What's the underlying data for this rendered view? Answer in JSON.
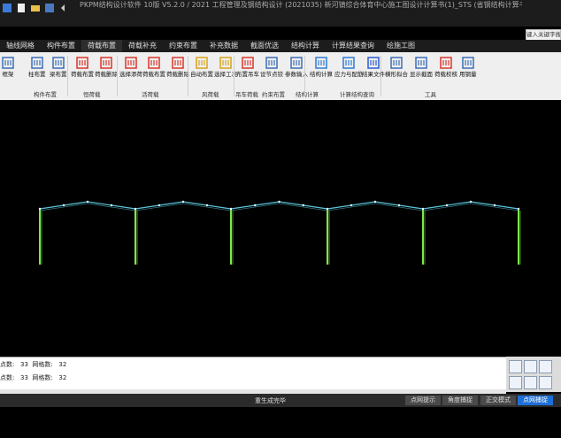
{
  "window": {
    "title": "PKPM结构设计软件 10版 V5.2.0 / 2021 工程管理及钢结构设计 (2021035) 新河镇综合体育中心施工图设计计算书(1)_STS (省钢结构计算书)",
    "search_placeholder": "键入关键字搜索"
  },
  "tabs": [
    "轴线网格",
    "构件布置",
    "荷载布置",
    "荷载补充",
    "约束布置",
    "补充数据",
    "截面优选",
    "结构计算",
    "计算结果查询",
    "绘施工图"
  ],
  "active_tab": 2,
  "ribbon": {
    "tools": [
      {
        "label": "框架",
        "icon": "frame-icon"
      },
      {
        "label": "柱布置",
        "icon": "column-icon"
      },
      {
        "label": "梁布置",
        "icon": "beam-icon"
      },
      {
        "label": "荷载布置",
        "icon": "load-arrows-icon"
      },
      {
        "label": "荷载删除",
        "icon": "load-delete-icon"
      },
      {
        "label": "选择添荷",
        "icon": "select-load-icon"
      },
      {
        "label": "荷载布置",
        "icon": "live-load-icon"
      },
      {
        "label": "荷载删除",
        "icon": "live-load-delete-icon"
      },
      {
        "label": "自动布置",
        "icon": "wind-auto-icon"
      },
      {
        "label": "选择工况",
        "icon": "wind-case-icon"
      },
      {
        "label": "布置吊车",
        "icon": "crane-icon"
      },
      {
        "label": "设节点铰",
        "icon": "hinge-icon"
      },
      {
        "label": "参数输入",
        "icon": "parameters-icon"
      },
      {
        "label": "结构计算",
        "icon": "run-icon"
      },
      {
        "label": "应力与配筋",
        "icon": "stress-icon"
      },
      {
        "label": "结果文件",
        "icon": "word-file-icon"
      },
      {
        "label": "横形拟合",
        "icon": "fit-icon"
      },
      {
        "label": "显示截面",
        "icon": "section-icon"
      },
      {
        "label": "荷载校核",
        "icon": "load-check-icon"
      },
      {
        "label": "用钢量",
        "icon": "steel-qty-icon"
      }
    ],
    "groups": [
      "构件布置",
      "恒荷载",
      "活荷载",
      "风荷载",
      "吊车荷载",
      "约束布置",
      "结构计算",
      "计算结构查询",
      "工具"
    ]
  },
  "command": {
    "lines": [
      "点数:   33  网格数:   32",
      "点数:   33  网格数:   32"
    ]
  },
  "status": {
    "message": "重生成完毕",
    "buttons": [
      "点网提示",
      "角度捕捉",
      "正交模式",
      "点网捕捉"
    ],
    "active_button": 3
  },
  "colors": {
    "background": "#000000",
    "column": "#7ee84a",
    "rafter": "#59c6dc",
    "node": "#ffffff",
    "accent": "#1e6fd6"
  }
}
